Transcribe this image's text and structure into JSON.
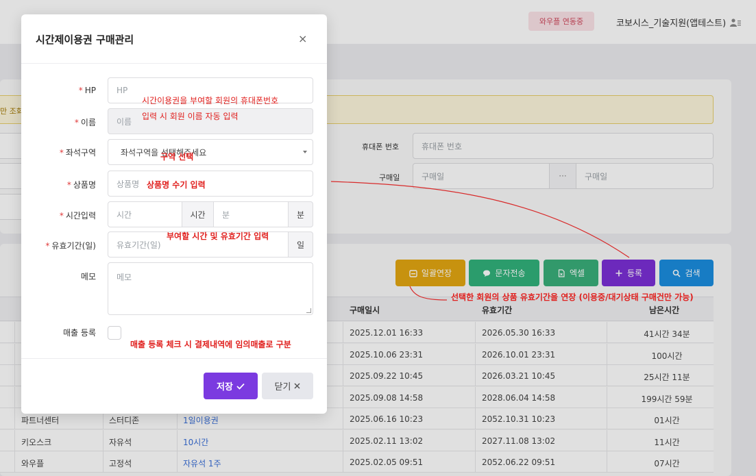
{
  "topbar": {
    "badge": "와우플 연동중",
    "user": "코보시스_기술지원(앱테스트)"
  },
  "alert": {
    "text": "만 조회"
  },
  "filters": {
    "phone_label": "휴대폰 번호",
    "phone_placeholder": "휴대폰 번호",
    "purchase_date_label": "구매일",
    "purchase_date_from": "구매일",
    "purchase_date_dots": "···",
    "purchase_date_to": "구매일"
  },
  "toolbar": {
    "extend": "일괄연장",
    "sms": "문자전송",
    "excel": "엑셀",
    "register": "등록",
    "search": "검색",
    "colors": {
      "extend": "#e3a712",
      "sms": "#31b27b",
      "excel": "#3aaf7a",
      "register": "#7b2fd6",
      "search": "#1b8ee0"
    }
  },
  "table": {
    "headers": [
      "구매일시",
      "유효기간",
      "남은시간"
    ],
    "rows": [
      {
        "c1": "",
        "c2": "",
        "c3": "",
        "purchased": "2025.12.01 16:33",
        "valid": "2026.05.30 16:33",
        "remain": "41시간 34분"
      },
      {
        "c1": "",
        "c2": "",
        "c3": "",
        "purchased": "2025.10.06 23:31",
        "valid": "2026.10.01 23:31",
        "remain": "100시간"
      },
      {
        "c1": "",
        "c2": "",
        "c3": "",
        "purchased": "2025.09.22 10:45",
        "valid": "2026.03.21 10:45",
        "remain": "25시간 11분"
      },
      {
        "c1": "",
        "c2": "",
        "c3": "",
        "purchased": "2025.09.08 14:58",
        "valid": "2028.06.04 14:58",
        "remain": "199시간 59분"
      },
      {
        "c1": "파트너센터",
        "c2": "스터디존",
        "c3": "1일이용권",
        "purchased": "2025.06.16 10:23",
        "valid": "2052.10.31 10:23",
        "remain": "01시간"
      },
      {
        "c1": "키오스크",
        "c2": "자유석",
        "c3": "10시간",
        "purchased": "2025.02.11 13:02",
        "valid": "2027.11.08 13:02",
        "remain": "11시간"
      },
      {
        "c1": "와우플",
        "c2": "고정석",
        "c3": "자유석 1주",
        "purchased": "2025.02.05 09:51",
        "valid": "2052.06.22 09:51",
        "remain": "07시간"
      }
    ]
  },
  "modal": {
    "title": "시간제이용권 구매관리",
    "close": "×",
    "fields": {
      "hp_label": "HP",
      "hp_placeholder": "HP",
      "name_label": "이름",
      "name_placeholder": "이름",
      "zone_label": "좌석구역",
      "zone_value": "좌석구역을 선택해주세요",
      "product_label": "상품명",
      "product_placeholder": "상품명",
      "time_label": "시간입력",
      "hour_placeholder": "시간",
      "hour_addon": "시간",
      "minute_placeholder": "분",
      "minute_addon": "분",
      "validity_label": "유효기간(일)",
      "validity_placeholder": "유효기간(일)",
      "validity_addon": "일",
      "memo_label": "메모",
      "memo_placeholder": "메모",
      "sales_label": "매출 등록"
    },
    "required_mark": "*",
    "save": "저장",
    "cancel": "닫기"
  },
  "annotations": {
    "hp_note_1": "시간이용권을 부여할 회원의 휴대폰번호",
    "hp_note_2": "입력 시 회원 이름 자동 입력",
    "zone_note": "구역 선택",
    "product_note": "상품명 수기 입력",
    "time_note": "부여할 시간 및 유효기간 입력",
    "extend_note": "선택한 회원의 상품 유효기간을 연장 (이용중/대기상태 구매건만 가능)",
    "sales_note": "매출 등록 체크 시 결제내역에 임의매출로 구분"
  }
}
